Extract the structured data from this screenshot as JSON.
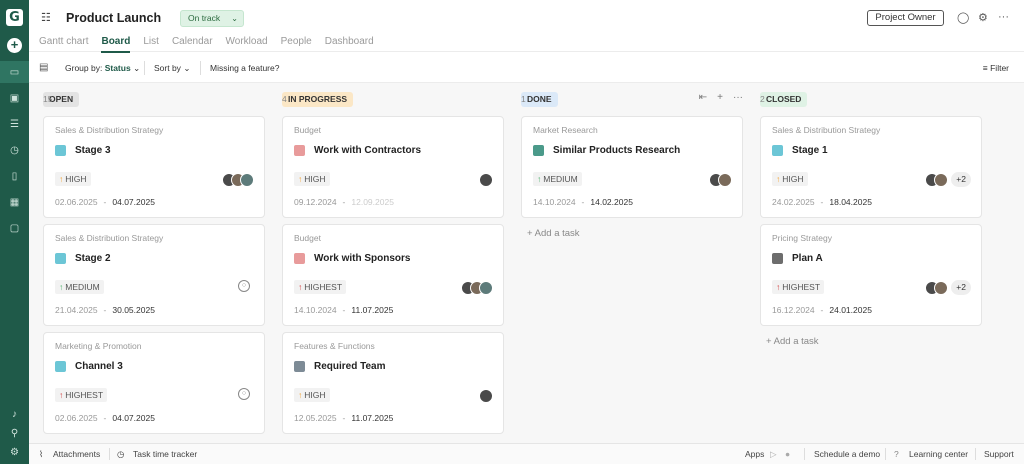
{
  "project": {
    "title": "Product Launch",
    "status": "On track",
    "owner_button": "Project Owner"
  },
  "tabs": [
    "Gantt chart",
    "Board",
    "List",
    "Calendar",
    "Workload",
    "People",
    "Dashboard"
  ],
  "toolbar": {
    "group_by_label": "Group by:",
    "group_by_value": "Status",
    "sort_by": "Sort by",
    "missing_feature": "Missing a feature?",
    "filter": "Filter"
  },
  "columns": [
    {
      "name": "OPEN",
      "count": "15",
      "color": "#e3e3e3",
      "cards": [
        {
          "group": "Sales & Distribution Strategy",
          "name": "Stage 3",
          "sq": "#6cc6d6",
          "arrow": "↑",
          "arrow_color": "#f0a030",
          "priority": "HIGH",
          "start": "02.06.2025",
          "end": "04.07.2025",
          "avatars": 3,
          "more": ""
        },
        {
          "group": "Sales & Distribution Strategy",
          "name": "Stage 2",
          "sq": "#6cc6d6",
          "arrow": "↑",
          "arrow_color": "#4caf6a",
          "priority": "MEDIUM",
          "start": "21.04.2025",
          "end": "30.05.2025",
          "avatars": 0,
          "more": ""
        },
        {
          "group": "Marketing & Promotion",
          "name": "Channel 3",
          "sq": "#6cc6d6",
          "arrow": "↑",
          "arrow_color": "#d23b3b",
          "priority": "HIGHEST",
          "start": "02.06.2025",
          "end": "04.07.2025",
          "avatars": 0,
          "more": ""
        }
      ]
    },
    {
      "name": "IN PROGRESS",
      "count": "4",
      "color": "#fbe7c6",
      "cards": [
        {
          "group": "Budget",
          "name": "Work with Contractors",
          "sq": "#e89b9b",
          "arrow": "↑",
          "arrow_color": "#f0a030",
          "priority": "HIGH",
          "start": "09.12.2024",
          "end": "12.09.2025",
          "end_past": true,
          "avatars": 1,
          "more": ""
        },
        {
          "group": "Budget",
          "name": "Work with Sponsors",
          "sq": "#e89b9b",
          "arrow": "↑",
          "arrow_color": "#d23b3b",
          "priority": "HIGHEST",
          "start": "14.10.2024",
          "end": "11.07.2025",
          "avatars": 3,
          "more": ""
        },
        {
          "group": "Features & Functions",
          "name": "Required Team",
          "sq": "#7d8b96",
          "arrow": "↑",
          "arrow_color": "#f0a030",
          "priority": "HIGH",
          "start": "12.05.2025",
          "end": "11.07.2025",
          "avatars": 1,
          "more": ""
        }
      ]
    },
    {
      "name": "DONE",
      "count": "1",
      "color": "#dbe9f8",
      "cards": [
        {
          "group": "Market Research",
          "name": "Similar Products Research",
          "sq": "#4b9a8a",
          "arrow": "↑",
          "arrow_color": "#4caf6a",
          "priority": "MEDIUM",
          "start": "14.10.2024",
          "end": "14.02.2025",
          "avatars": 2,
          "more": ""
        }
      ]
    },
    {
      "name": "CLOSED",
      "count": "2",
      "color": "#dff2e5",
      "cards": [
        {
          "group": "Sales & Distribution Strategy",
          "name": "Stage 1",
          "sq": "#6cc6d6",
          "arrow": "↑",
          "arrow_color": "#f0a030",
          "priority": "HIGH",
          "start": "24.02.2025",
          "end": "18.04.2025",
          "avatars": 2,
          "more": "+2"
        },
        {
          "group": "Pricing Strategy",
          "name": "Plan A",
          "sq": "#6d6d6d",
          "arrow": "↑",
          "arrow_color": "#d23b3b",
          "priority": "HIGHEST",
          "start": "16.12.2024",
          "end": "24.01.2025",
          "avatars": 2,
          "more": "+2"
        }
      ]
    }
  ],
  "add_task": "+ Add a task",
  "footer": {
    "attachments": "Attachments",
    "time_tracker": "Task time tracker",
    "apps": "Apps",
    "demo": "Schedule a demo",
    "learning": "Learning center",
    "support": "Support"
  }
}
